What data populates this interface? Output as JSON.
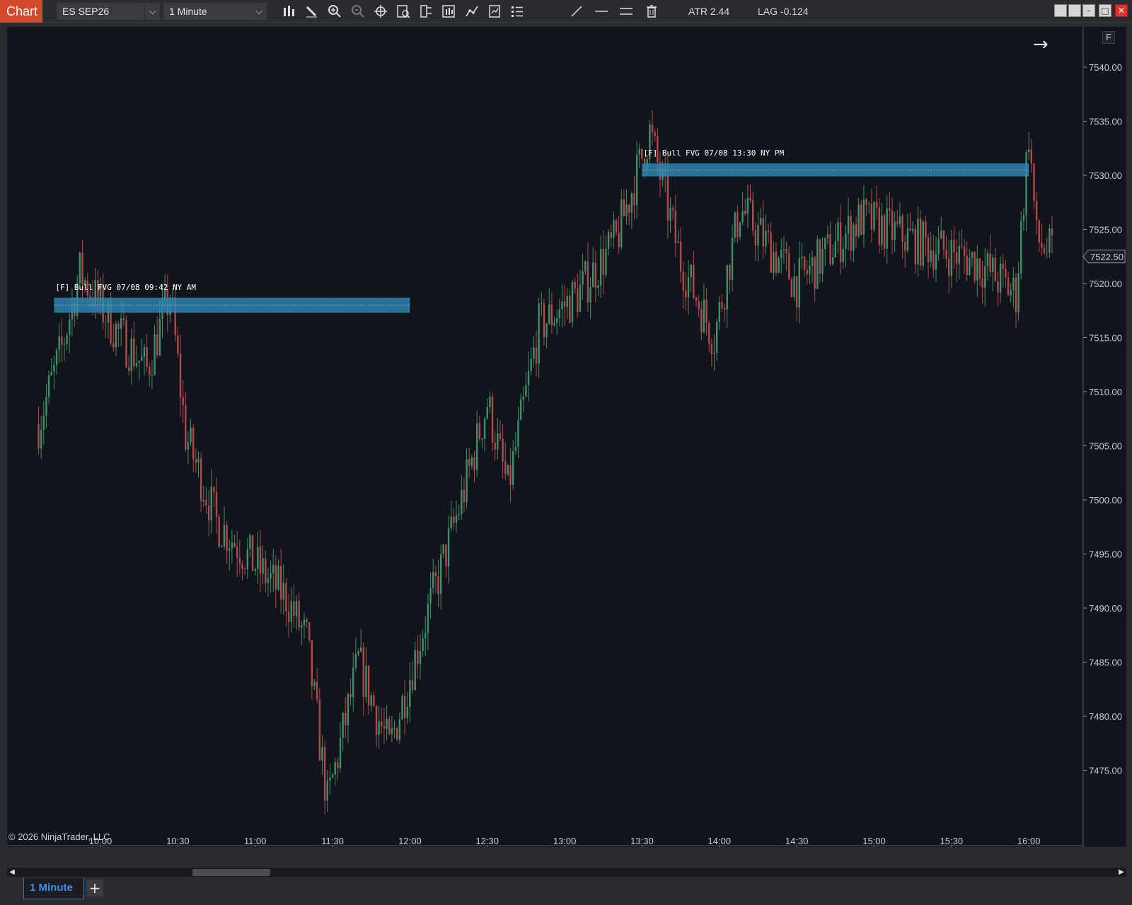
{
  "toolbar": {
    "chart_tab_label": "Chart",
    "instrument": "ES SEP26",
    "timeframe": "1 Minute",
    "atr_text": "ATR 2.44",
    "lag_text": "LAG -0.124",
    "icons": [
      "bar-type-icon",
      "pencil-icon",
      "zoom-in-icon",
      "zoom-out-icon",
      "crosshair-icon",
      "data-box-icon",
      "properties-icon",
      "fit-icon",
      "indicators-icon",
      "strategies-icon",
      "object-list-icon",
      "draw-line-icon",
      "horizontal-line-icon",
      "double-line-icon",
      "trash-icon"
    ]
  },
  "window_controls": {
    "close_symbol": "✕",
    "maximize_symbol": "□",
    "minimize_symbol": "–"
  },
  "chart": {
    "f_button": "F",
    "copyright": "© 2026 NinjaTrader, LLC",
    "current_price_label": "7522.50",
    "price_ticks": [
      "7540.00",
      "7535.00",
      "7530.00",
      "7525.00",
      "7520.00",
      "7515.00",
      "7510.00",
      "7505.00",
      "7500.00",
      "7495.00",
      "7490.00",
      "7485.00",
      "7480.00",
      "7475.00"
    ],
    "time_ticks": [
      "10:00",
      "10:30",
      "11:00",
      "11:30",
      "12:00",
      "12:30",
      "13:00",
      "13:30",
      "14:00",
      "14:30",
      "15:00",
      "15:30",
      "16:00"
    ],
    "fvg_zones": [
      {
        "label": "[F]  Bull FVG  07/08  09:42  NY AM",
        "top": 7518.7,
        "bottom": 7517.3,
        "start": "09:42",
        "end": "12:00"
      },
      {
        "label": "[F]  Bull FVG  07/08  13:30  NY PM",
        "top": 7531.1,
        "bottom": 7529.9,
        "start": "13:30",
        "end": "16:00"
      }
    ],
    "colors": {
      "background": "#11141b",
      "up_candle": "#3f8f6b",
      "down_candle": "#b24a4a",
      "fvg_fill": "#2e87b5",
      "accent": "#d4482b"
    }
  },
  "chart_data": {
    "type": "candlestick",
    "title": "ES SEP26",
    "xlabel": "",
    "ylabel": "",
    "ylim": [
      7469.5,
      7542.5
    ],
    "x_range": [
      "09:37",
      "16:10"
    ],
    "key_points": [
      {
        "t": "09:36",
        "p": 7507
      },
      {
        "t": "09:45",
        "p": 7514
      },
      {
        "t": "09:52",
        "p": 7521
      },
      {
        "t": "10:05",
        "p": 7516
      },
      {
        "t": "10:18",
        "p": 7512
      },
      {
        "t": "10:27",
        "p": 7519
      },
      {
        "t": "10:33",
        "p": 7506
      },
      {
        "t": "10:45",
        "p": 7498
      },
      {
        "t": "11:00",
        "p": 7494
      },
      {
        "t": "11:12",
        "p": 7491
      },
      {
        "t": "11:20",
        "p": 7487
      },
      {
        "t": "11:28",
        "p": 7472
      },
      {
        "t": "11:40",
        "p": 7485
      },
      {
        "t": "11:52",
        "p": 7477
      },
      {
        "t": "12:05",
        "p": 7488
      },
      {
        "t": "12:20",
        "p": 7500
      },
      {
        "t": "12:30",
        "p": 7509
      },
      {
        "t": "12:38",
        "p": 7501
      },
      {
        "t": "12:50",
        "p": 7516
      },
      {
        "t": "13:05",
        "p": 7519
      },
      {
        "t": "13:20",
        "p": 7524
      },
      {
        "t": "13:33",
        "p": 7534
      },
      {
        "t": "13:45",
        "p": 7522
      },
      {
        "t": "13:58",
        "p": 7515
      },
      {
        "t": "14:08",
        "p": 7527
      },
      {
        "t": "14:30",
        "p": 7520
      },
      {
        "t": "14:55",
        "p": 7526
      },
      {
        "t": "15:15",
        "p": 7524
      },
      {
        "t": "15:40",
        "p": 7522
      },
      {
        "t": "15:55",
        "p": 7519
      },
      {
        "t": "16:00",
        "p": 7534
      },
      {
        "t": "16:03",
        "p": 7524
      },
      {
        "t": "16:10",
        "p": 7522.5
      }
    ]
  }
}
